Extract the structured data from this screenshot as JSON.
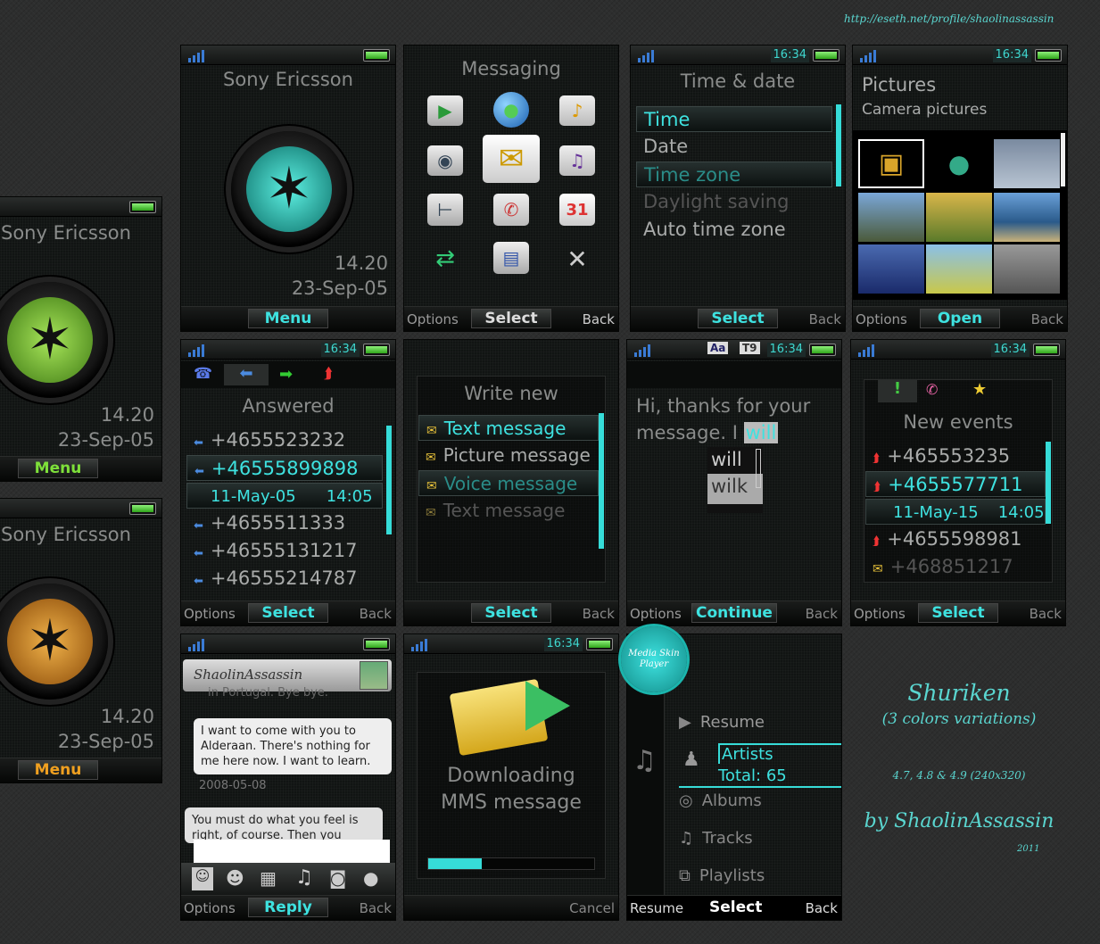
{
  "credit_url": "http://eseth.net/profile/shaolinassassin",
  "clock": "16:34",
  "standby": {
    "brand": "Sony Ericsson",
    "time": "14.20",
    "date": "23-Sep-05",
    "menu": "Menu"
  },
  "messaging": {
    "title": "Messaging",
    "left": "Options",
    "center": "Select",
    "right": "Back",
    "icons": [
      "play-icon",
      "globe-icon",
      "media-icon",
      "camera-icon",
      "envelope-icon",
      "music-file-icon",
      "settings-icon",
      "phone-book-icon",
      "calendar-icon",
      "transfer-icon",
      "document-icon",
      "tools-icon"
    ],
    "calendar_day": "31"
  },
  "time_date": {
    "title": "Time & date",
    "items": [
      "Time",
      "Date",
      "Time zone",
      "Daylight saving",
      "Auto time zone"
    ],
    "center": "Select",
    "right": "Back"
  },
  "pictures": {
    "title": "Pictures",
    "subtitle": "Camera pictures",
    "left": "Options",
    "center": "Open",
    "right": "Back"
  },
  "calls": {
    "title": "Answered",
    "numbers": [
      "+4655523232",
      "+46555899898",
      "+4655511333",
      "+46555131217",
      "+46555214787"
    ],
    "detail_date": "11-May-05",
    "detail_time": "14:05",
    "left": "Options",
    "center": "Select",
    "right": "Back"
  },
  "write_new": {
    "title": "Write new",
    "items": [
      "Text message",
      "Picture message",
      "Voice message",
      "Text message"
    ],
    "center": "Select",
    "right": "Back"
  },
  "compose": {
    "text_line1": "Hi, thanks for your",
    "text_line2": "message. I",
    "highlight": "will",
    "suggestions": [
      "will",
      "wilk"
    ],
    "mode_a": "Aa",
    "mode_b": "T9",
    "left": "Options",
    "center": "Continue",
    "right": "Back"
  },
  "events": {
    "title": "New events",
    "numbers": [
      "+465553235",
      "+4655577711",
      "+4655598981",
      "+468851217"
    ],
    "detail_date": "11-May-15",
    "detail_time": "14:05",
    "left": "Options",
    "center": "Select",
    "right": "Back"
  },
  "chat": {
    "user": "ShaolinAssassin",
    "prev": "in Portugal. Bye bye.",
    "bubble1": "I want to come with you to Alderaan. There's nothing for me here now. I want to learn.",
    "timestamp": "2008-05-08",
    "bubble2": "You must do what you feel is right, of course. Then you",
    "left": "Options",
    "center": "Reply",
    "right": "Back"
  },
  "download": {
    "line1": "Downloading",
    "line2": "MMS message",
    "progress": 0.32,
    "right": "Cancel"
  },
  "player": {
    "badge": "Media Skin Player",
    "items": [
      "Resume",
      "Artists",
      "Albums",
      "Tracks",
      "Playlists"
    ],
    "total": "Total: 65",
    "left": "Resume",
    "center": "Select",
    "right": "Back"
  },
  "branding": {
    "name": "Shuriken",
    "variants": "(3 colors variations)",
    "versions": "4.7, 4.8 & 4.9 (240x320)",
    "author": "by ShaolinAssassin",
    "year": "2011"
  },
  "colors": {
    "accent": "#3ee2e0",
    "teal_orb": "#1bb5ad",
    "green_orb": "#7cc13a",
    "orange_orb": "#d98a1e"
  }
}
